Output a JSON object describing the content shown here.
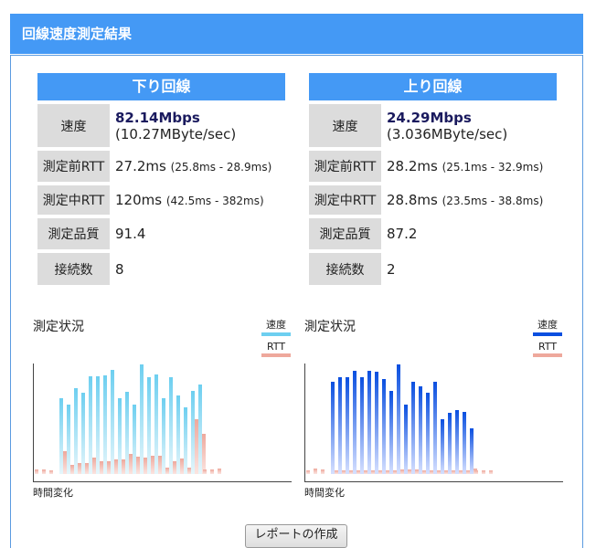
{
  "header": {
    "title": "回線速度測定結果"
  },
  "down": {
    "title": "下り回線",
    "rows": [
      {
        "label": "速度",
        "value": "82.14Mbps",
        "sub": "(10.27MByte/sec)"
      },
      {
        "label": "測定前RTT",
        "value": "27.2ms",
        "detail": "(25.8ms - 28.9ms)"
      },
      {
        "label": "測定中RTT",
        "value": "120ms",
        "detail": "(42.5ms - 382ms)"
      },
      {
        "label": "測定品質",
        "value": "91.4"
      },
      {
        "label": "接続数",
        "value": "8"
      }
    ]
  },
  "up": {
    "title": "上り回線",
    "rows": [
      {
        "label": "速度",
        "value": "24.29Mbps",
        "sub": "(3.036MByte/sec)"
      },
      {
        "label": "測定前RTT",
        "value": "28.2ms",
        "detail": "(25.1ms - 32.9ms)"
      },
      {
        "label": "測定中RTT",
        "value": "28.8ms",
        "detail": "(23.5ms - 38.8ms)"
      },
      {
        "label": "測定品質",
        "value": "87.2"
      },
      {
        "label": "接続数",
        "value": "2"
      }
    ]
  },
  "chart_data": [
    {
      "type": "bar",
      "title": "測定状況",
      "xlabel": "時間変化",
      "legend": [
        "速度",
        "RTT"
      ],
      "colors": {
        "speed": "#6dcff0",
        "rtt": "#eea89c"
      },
      "speed": [
        null,
        null,
        null,
        69,
        63,
        78,
        74,
        89,
        89,
        90,
        95,
        69,
        75,
        63,
        100,
        88,
        91,
        69,
        88,
        72,
        61,
        76,
        82,
        null,
        null,
        null
      ],
      "rtt": [
        4,
        4,
        3,
        21,
        8,
        10,
        10,
        15,
        12,
        12,
        13,
        13,
        18,
        16,
        15,
        17,
        17,
        6,
        12,
        14,
        6,
        50,
        37,
        4,
        4,
        5
      ]
    },
    {
      "type": "bar",
      "title": "測定状況",
      "xlabel": "時間変化",
      "legend": [
        "速度",
        "RTT"
      ],
      "colors": {
        "speed": "#0a4fe0",
        "rtt": "#eea89c"
      },
      "speed": [
        null,
        null,
        null,
        84,
        88,
        88,
        94,
        88,
        94,
        93,
        87,
        76,
        100,
        63,
        84,
        80,
        74,
        84,
        50,
        56,
        58,
        57,
        42,
        null,
        null,
        null
      ],
      "rtt": [
        3,
        5,
        4,
        3,
        3,
        3,
        3,
        3,
        3,
        3,
        3,
        3,
        4,
        4,
        4,
        3,
        3,
        3,
        3,
        3,
        3,
        3,
        5,
        3,
        3,
        3
      ]
    }
  ],
  "button": {
    "label": "レポートの作成"
  }
}
